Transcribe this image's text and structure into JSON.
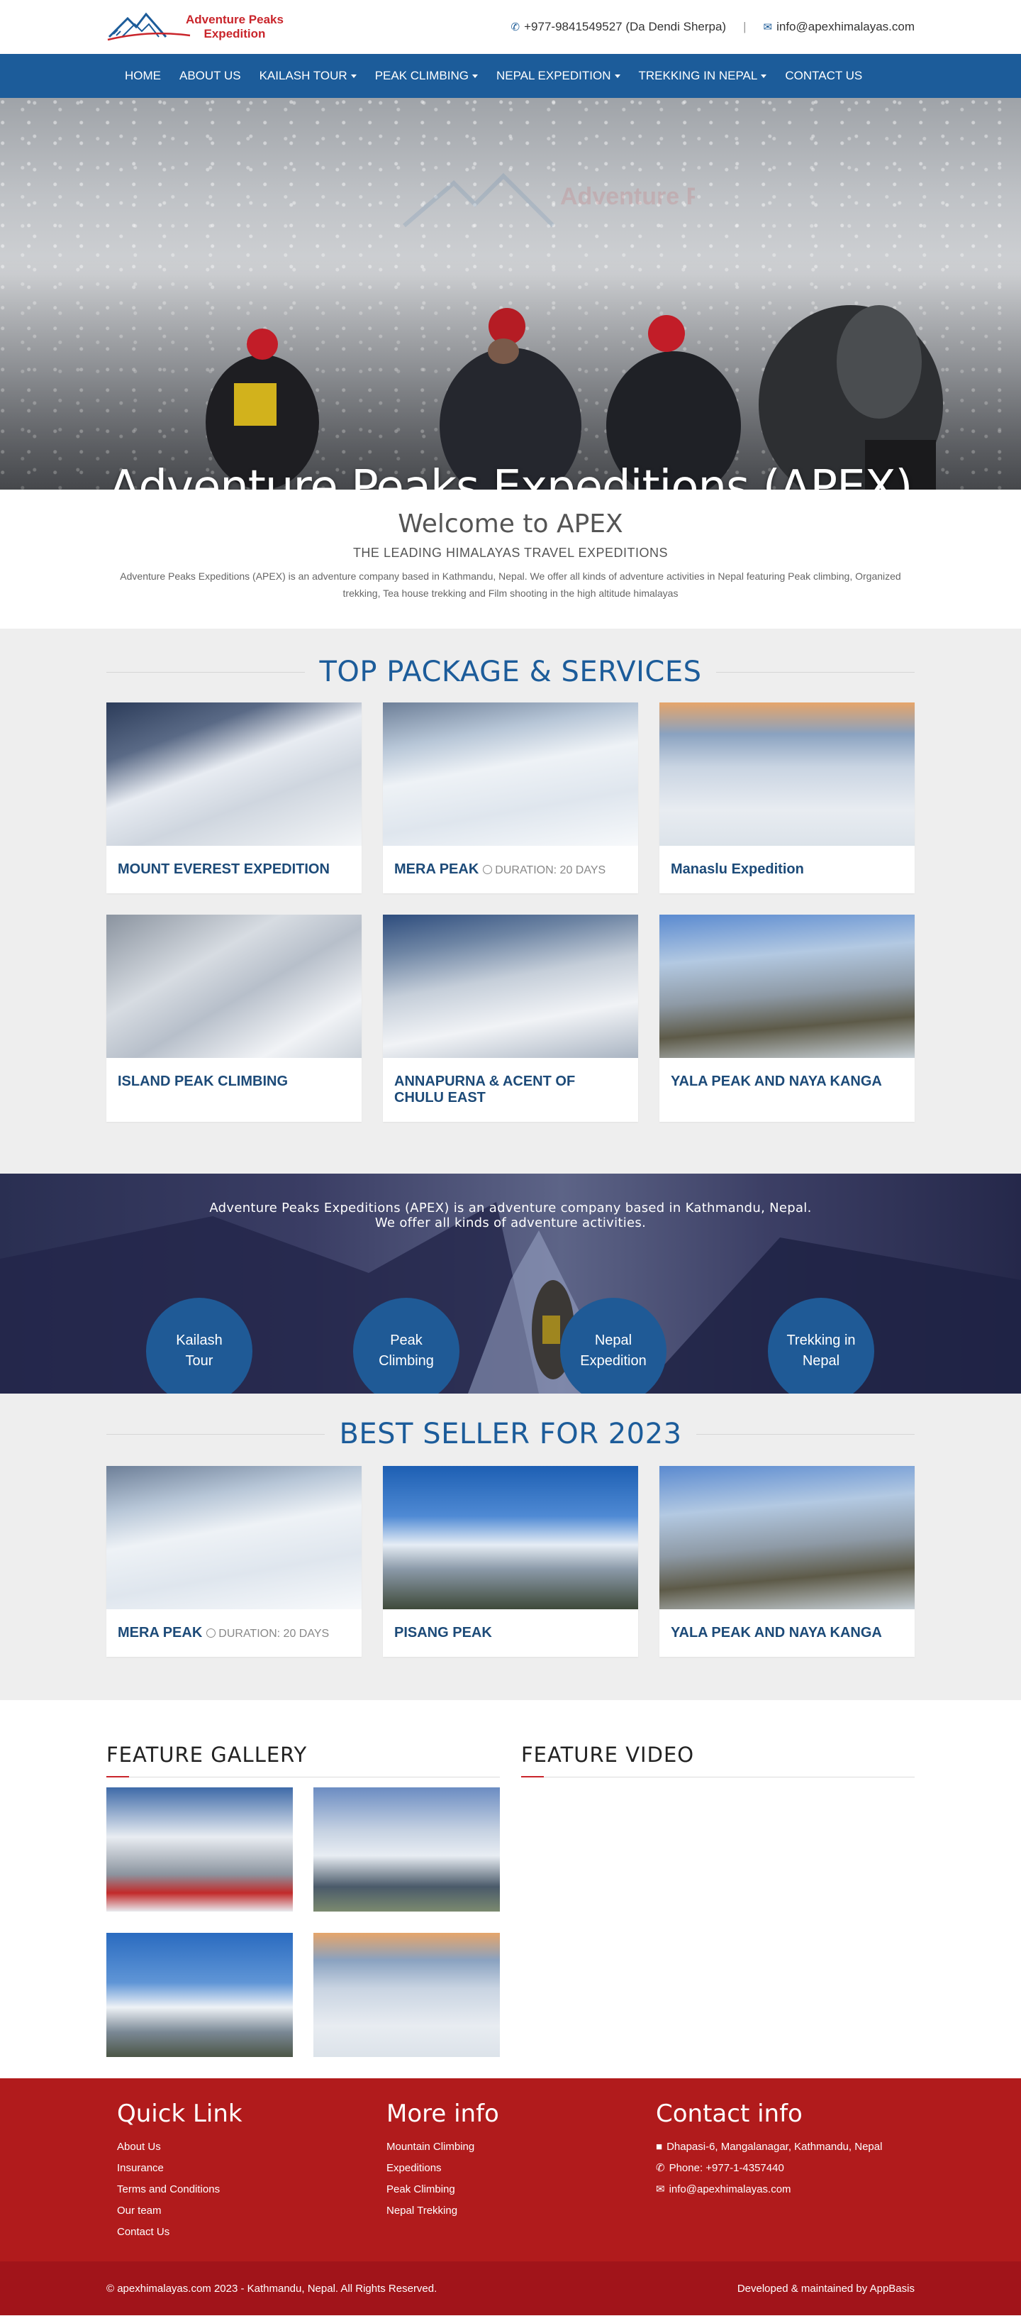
{
  "header": {
    "logo_text_line1": "Adventure Peaks",
    "logo_text_line2": "Expedition",
    "phone": "+977-9841549527 (Da Dendi Sherpa)",
    "separator": "|",
    "email": "info@apexhimalayas.com"
  },
  "nav": {
    "items": [
      {
        "label": "HOME",
        "dropdown": false
      },
      {
        "label": "ABOUT US",
        "dropdown": false
      },
      {
        "label": "KAILASH TOUR",
        "dropdown": true
      },
      {
        "label": "PEAK CLIMBING",
        "dropdown": true
      },
      {
        "label": "NEPAL EXPEDITION",
        "dropdown": true
      },
      {
        "label": "TREKKING IN NEPAL",
        "dropdown": true
      },
      {
        "label": "CONTACT US",
        "dropdown": false
      }
    ]
  },
  "hero": {
    "title": "Adventure Peaks Expeditions (APEX)"
  },
  "welcome": {
    "title": "Welcome to APEX",
    "subtitle": "THE LEADING HIMALAYAS TRAVEL EXPEDITIONS",
    "text": "Adventure Peaks Expeditions (APEX) is an adventure company based in Kathmandu, Nepal. We offer all kinds of adventure activities in Nepal featuring Peak climbing, Organized trekking, Tea house trekking and Film shooting in the high altitude himalayas"
  },
  "packages": {
    "title": "TOP PACKAGE & SERVICES",
    "items": [
      {
        "title": "MOUNT EVEREST EXPEDITION",
        "duration": ""
      },
      {
        "title": "MERA PEAK",
        "duration": "DURATION: 20 DAYS"
      },
      {
        "title": "Manaslu Expedition",
        "duration": ""
      },
      {
        "title": "ISLAND PEAK CLIMBING",
        "duration": ""
      },
      {
        "title": "ANNAPURNA & ACENT OF CHULU EAST",
        "duration": ""
      },
      {
        "title": "YALA PEAK AND NAYA KANGA",
        "duration": ""
      }
    ]
  },
  "band": {
    "line1": "Adventure Peaks Expeditions (APEX) is an adventure company based in Kathmandu, Nepal.",
    "line2": "We offer all kinds of adventure activities.",
    "services": [
      "Kailash Tour",
      "Peak Climbing",
      "Nepal Expedition",
      "Trekking in Nepal"
    ]
  },
  "best": {
    "title": "BEST SELLER FOR 2023",
    "items": [
      {
        "title": "MERA PEAK",
        "duration": "DURATION: 20 DAYS"
      },
      {
        "title": "PISANG PEAK",
        "duration": ""
      },
      {
        "title": "YALA PEAK AND NAYA KANGA",
        "duration": ""
      }
    ]
  },
  "gallery": {
    "title": "FEATURE GALLERY",
    "video_title": "FEATURE VIDEO"
  },
  "footer": {
    "quick_title": "Quick Link",
    "quick_links": [
      "About Us",
      "Insurance",
      "Terms and Conditions",
      "Our team",
      "Contact Us"
    ],
    "more_title": "More info",
    "more_links": [
      "Mountain Climbing",
      "Expeditions",
      "Peak Climbing",
      "Nepal Trekking"
    ],
    "contact_title": "Contact info",
    "address": "Dhapasi-6, Mangalanagar, Kathmandu, Nepal",
    "phone": "Phone: +977-1-4357440",
    "email": "info@apexhimalayas.com",
    "copyright": "© apexhimalayas.com 2023 - Kathmandu, Nepal. All Rights Reserved.",
    "developer": "Developed & maintained by AppBasis"
  },
  "colors": {
    "brand_blue": "#1c5c9a",
    "brand_red": "#b11b1c",
    "logo_red": "#c9252b"
  }
}
